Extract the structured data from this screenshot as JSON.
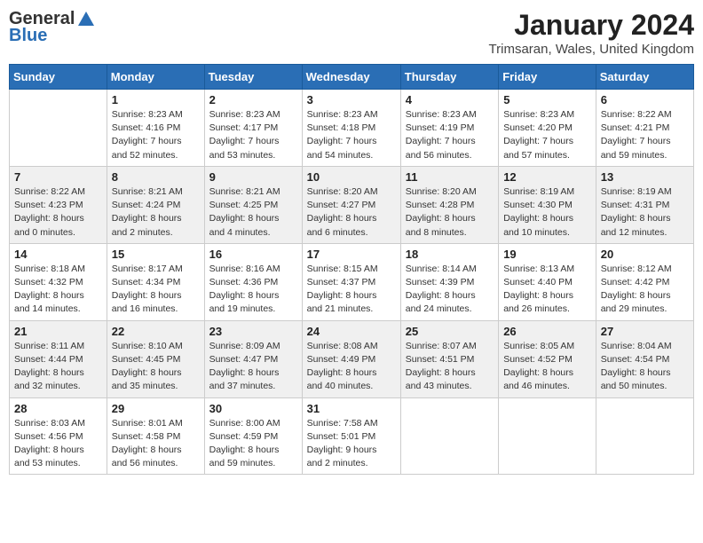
{
  "header": {
    "logo_general": "General",
    "logo_blue": "Blue",
    "month": "January 2024",
    "location": "Trimsaran, Wales, United Kingdom"
  },
  "days_of_week": [
    "Sunday",
    "Monday",
    "Tuesday",
    "Wednesday",
    "Thursday",
    "Friday",
    "Saturday"
  ],
  "weeks": [
    [
      {
        "day": "",
        "text": ""
      },
      {
        "day": "1",
        "text": "Sunrise: 8:23 AM\nSunset: 4:16 PM\nDaylight: 7 hours\nand 52 minutes."
      },
      {
        "day": "2",
        "text": "Sunrise: 8:23 AM\nSunset: 4:17 PM\nDaylight: 7 hours\nand 53 minutes."
      },
      {
        "day": "3",
        "text": "Sunrise: 8:23 AM\nSunset: 4:18 PM\nDaylight: 7 hours\nand 54 minutes."
      },
      {
        "day": "4",
        "text": "Sunrise: 8:23 AM\nSunset: 4:19 PM\nDaylight: 7 hours\nand 56 minutes."
      },
      {
        "day": "5",
        "text": "Sunrise: 8:23 AM\nSunset: 4:20 PM\nDaylight: 7 hours\nand 57 minutes."
      },
      {
        "day": "6",
        "text": "Sunrise: 8:22 AM\nSunset: 4:21 PM\nDaylight: 7 hours\nand 59 minutes."
      }
    ],
    [
      {
        "day": "7",
        "text": "Sunrise: 8:22 AM\nSunset: 4:23 PM\nDaylight: 8 hours\nand 0 minutes."
      },
      {
        "day": "8",
        "text": "Sunrise: 8:21 AM\nSunset: 4:24 PM\nDaylight: 8 hours\nand 2 minutes."
      },
      {
        "day": "9",
        "text": "Sunrise: 8:21 AM\nSunset: 4:25 PM\nDaylight: 8 hours\nand 4 minutes."
      },
      {
        "day": "10",
        "text": "Sunrise: 8:20 AM\nSunset: 4:27 PM\nDaylight: 8 hours\nand 6 minutes."
      },
      {
        "day": "11",
        "text": "Sunrise: 8:20 AM\nSunset: 4:28 PM\nDaylight: 8 hours\nand 8 minutes."
      },
      {
        "day": "12",
        "text": "Sunrise: 8:19 AM\nSunset: 4:30 PM\nDaylight: 8 hours\nand 10 minutes."
      },
      {
        "day": "13",
        "text": "Sunrise: 8:19 AM\nSunset: 4:31 PM\nDaylight: 8 hours\nand 12 minutes."
      }
    ],
    [
      {
        "day": "14",
        "text": "Sunrise: 8:18 AM\nSunset: 4:32 PM\nDaylight: 8 hours\nand 14 minutes."
      },
      {
        "day": "15",
        "text": "Sunrise: 8:17 AM\nSunset: 4:34 PM\nDaylight: 8 hours\nand 16 minutes."
      },
      {
        "day": "16",
        "text": "Sunrise: 8:16 AM\nSunset: 4:36 PM\nDaylight: 8 hours\nand 19 minutes."
      },
      {
        "day": "17",
        "text": "Sunrise: 8:15 AM\nSunset: 4:37 PM\nDaylight: 8 hours\nand 21 minutes."
      },
      {
        "day": "18",
        "text": "Sunrise: 8:14 AM\nSunset: 4:39 PM\nDaylight: 8 hours\nand 24 minutes."
      },
      {
        "day": "19",
        "text": "Sunrise: 8:13 AM\nSunset: 4:40 PM\nDaylight: 8 hours\nand 26 minutes."
      },
      {
        "day": "20",
        "text": "Sunrise: 8:12 AM\nSunset: 4:42 PM\nDaylight: 8 hours\nand 29 minutes."
      }
    ],
    [
      {
        "day": "21",
        "text": "Sunrise: 8:11 AM\nSunset: 4:44 PM\nDaylight: 8 hours\nand 32 minutes."
      },
      {
        "day": "22",
        "text": "Sunrise: 8:10 AM\nSunset: 4:45 PM\nDaylight: 8 hours\nand 35 minutes."
      },
      {
        "day": "23",
        "text": "Sunrise: 8:09 AM\nSunset: 4:47 PM\nDaylight: 8 hours\nand 37 minutes."
      },
      {
        "day": "24",
        "text": "Sunrise: 8:08 AM\nSunset: 4:49 PM\nDaylight: 8 hours\nand 40 minutes."
      },
      {
        "day": "25",
        "text": "Sunrise: 8:07 AM\nSunset: 4:51 PM\nDaylight: 8 hours\nand 43 minutes."
      },
      {
        "day": "26",
        "text": "Sunrise: 8:05 AM\nSunset: 4:52 PM\nDaylight: 8 hours\nand 46 minutes."
      },
      {
        "day": "27",
        "text": "Sunrise: 8:04 AM\nSunset: 4:54 PM\nDaylight: 8 hours\nand 50 minutes."
      }
    ],
    [
      {
        "day": "28",
        "text": "Sunrise: 8:03 AM\nSunset: 4:56 PM\nDaylight: 8 hours\nand 53 minutes."
      },
      {
        "day": "29",
        "text": "Sunrise: 8:01 AM\nSunset: 4:58 PM\nDaylight: 8 hours\nand 56 minutes."
      },
      {
        "day": "30",
        "text": "Sunrise: 8:00 AM\nSunset: 4:59 PM\nDaylight: 8 hours\nand 59 minutes."
      },
      {
        "day": "31",
        "text": "Sunrise: 7:58 AM\nSunset: 5:01 PM\nDaylight: 9 hours\nand 2 minutes."
      },
      {
        "day": "",
        "text": ""
      },
      {
        "day": "",
        "text": ""
      },
      {
        "day": "",
        "text": ""
      }
    ]
  ]
}
